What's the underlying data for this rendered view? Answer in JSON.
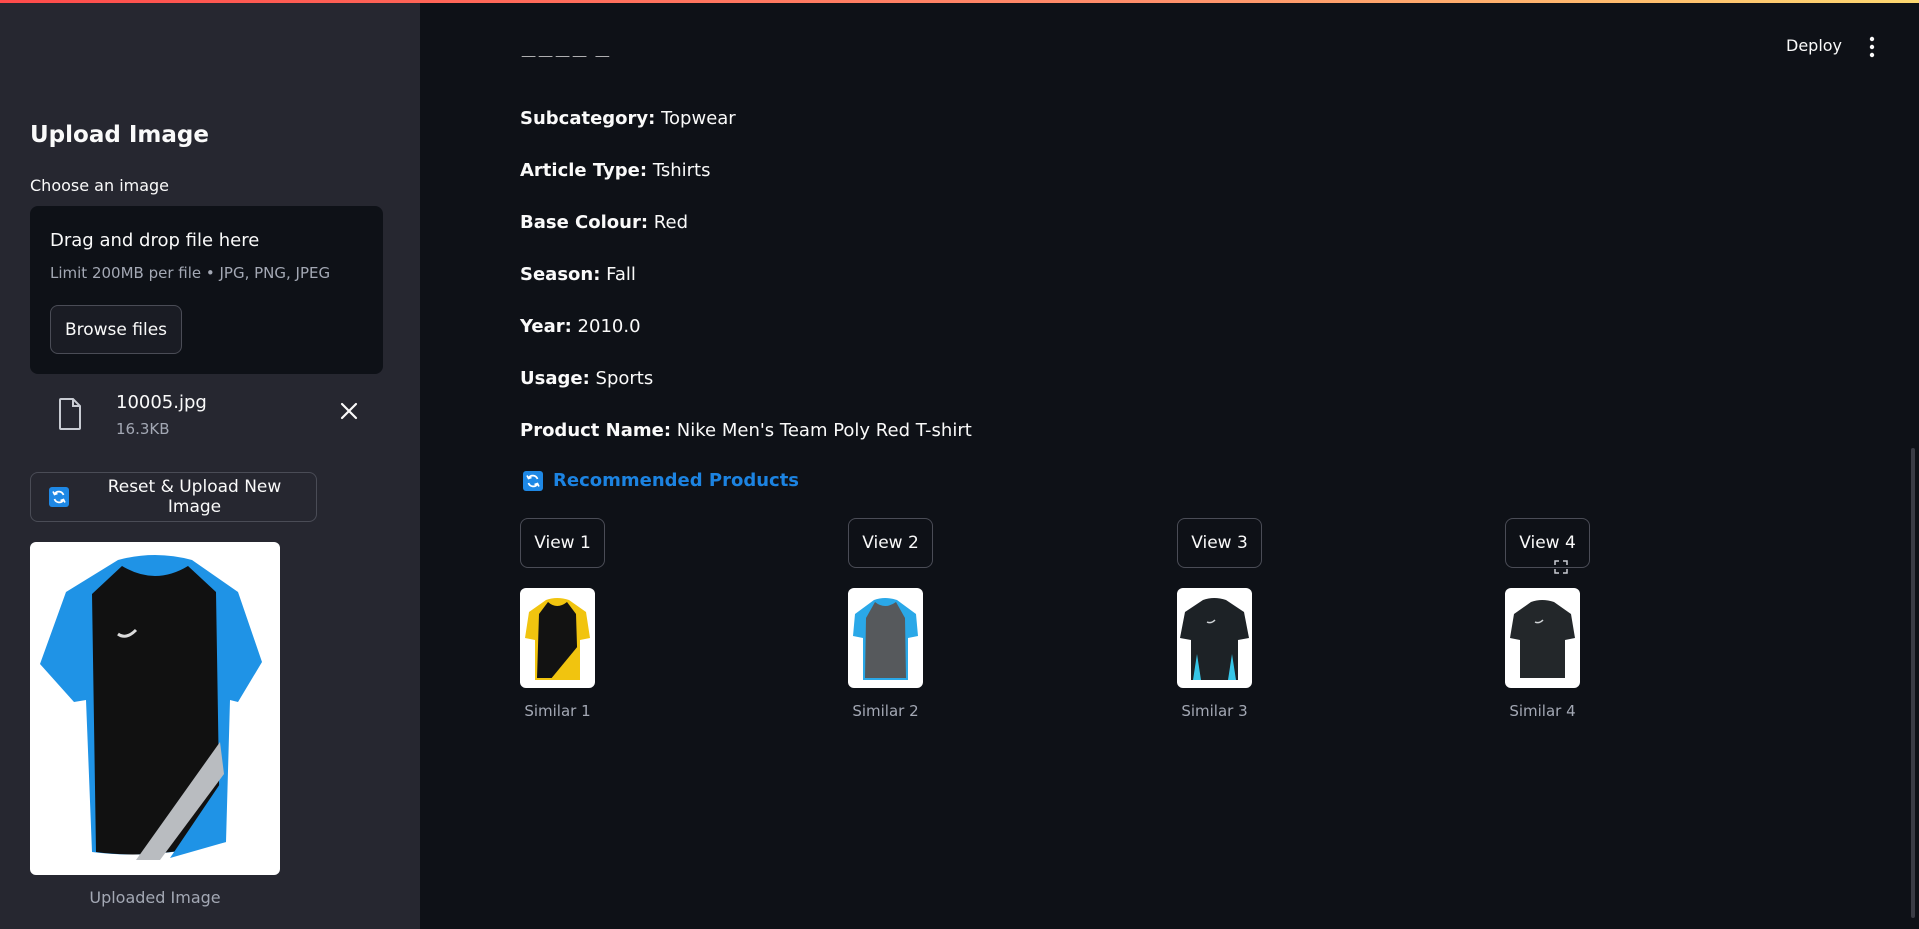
{
  "header": {
    "deploy_label": "Deploy",
    "menu_icon": "more-vert-icon"
  },
  "sidebar": {
    "title": "Upload Image",
    "uploader_label": "Choose an image",
    "dropzone_title": "Drag and drop file here",
    "dropzone_limit": "Limit 200MB per file • JPG, PNG, JPEG",
    "browse_label": "Browse files",
    "file": {
      "name": "10005.jpg",
      "size": "16.3KB"
    },
    "reset_label": "Reset & Upload New Image",
    "uploaded_caption": "Uploaded Image"
  },
  "details": {
    "subcategory_label": "Subcategory:",
    "subcategory": "Topwear",
    "article_type_label": "Article Type:",
    "article_type": "Tshirts",
    "base_colour_label": "Base Colour:",
    "base_colour": "Red",
    "season_label": "Season:",
    "season": "Fall",
    "year_label": "Year:",
    "year": "2010.0",
    "usage_label": "Usage:",
    "usage": "Sports",
    "product_name_label": "Product Name:",
    "product_name": "Nike Men's Team Poly Red T-shirt"
  },
  "recommendations": {
    "heading": "Recommended Products",
    "items": [
      {
        "button": "View 1",
        "caption": "Similar 1"
      },
      {
        "button": "View 2",
        "caption": "Similar 2"
      },
      {
        "button": "View 3",
        "caption": "Similar 3"
      },
      {
        "button": "View 4",
        "caption": "Similar 4"
      }
    ]
  },
  "colors": {
    "accent": "#1c83e1",
    "background": "#0e1117",
    "sidebar": "#262730"
  }
}
